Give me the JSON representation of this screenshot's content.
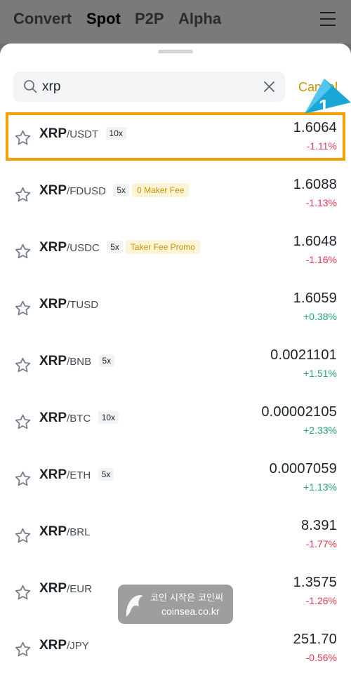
{
  "top_nav": {
    "tabs": [
      "Convert",
      "Spot",
      "P2P",
      "Alpha"
    ],
    "active_tab": "Spot",
    "menu_icon": "hamburger-menu-icon"
  },
  "search": {
    "value": "xrp",
    "cancel_label": "Cancel",
    "icon": "search-icon",
    "clear_icon": "close-icon"
  },
  "results": [
    {
      "base": "XRP",
      "quote": "/USDT",
      "leverage": "10x",
      "promo": "",
      "price": "1.6064",
      "change": "-1.11%",
      "direction": "down",
      "highlighted": true
    },
    {
      "base": "XRP",
      "quote": "/FDUSD",
      "leverage": "5x",
      "promo": "0 Maker Fee",
      "price": "1.6088",
      "change": "-1.13%",
      "direction": "down"
    },
    {
      "base": "XRP",
      "quote": "/USDC",
      "leverage": "5x",
      "promo": "Taker Fee Promo",
      "price": "1.6048",
      "change": "-1.16%",
      "direction": "down"
    },
    {
      "base": "XRP",
      "quote": "/TUSD",
      "leverage": "",
      "promo": "",
      "price": "1.6059",
      "change": "+0.38%",
      "direction": "up"
    },
    {
      "base": "XRP",
      "quote": "/BNB",
      "leverage": "5x",
      "promo": "",
      "price": "0.0021101",
      "change": "+1.51%",
      "direction": "up"
    },
    {
      "base": "XRP",
      "quote": "/BTC",
      "leverage": "10x",
      "promo": "",
      "price": "0.00002105",
      "change": "+2.33%",
      "direction": "up"
    },
    {
      "base": "XRP",
      "quote": "/ETH",
      "leverage": "5x",
      "promo": "",
      "price": "0.0007059",
      "change": "+1.13%",
      "direction": "up"
    },
    {
      "base": "XRP",
      "quote": "/BRL",
      "leverage": "",
      "promo": "",
      "price": "8.391",
      "change": "-1.77%",
      "direction": "down"
    },
    {
      "base": "XRP",
      "quote": "/EUR",
      "leverage": "",
      "promo": "",
      "price": "1.3575",
      "change": "-1.26%",
      "direction": "down"
    },
    {
      "base": "XRP",
      "quote": "/JPY",
      "leverage": "",
      "promo": "",
      "price": "251.70",
      "change": "-0.56%",
      "direction": "down"
    }
  ],
  "annotation": {
    "number": "1"
  },
  "watermark": {
    "line1": "코인 시작은 코인씨",
    "line2": "coinsea.co.kr"
  },
  "colors": {
    "accent": "#c99400",
    "negative": "#e0384f",
    "positive": "#20a56e",
    "highlight": "#f5a000",
    "marker": "#1aa7d8"
  }
}
